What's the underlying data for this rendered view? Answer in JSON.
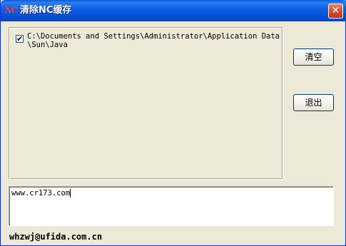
{
  "window": {
    "title": "清除NC缓存",
    "app_icon_text": "NC",
    "close_glyph": "✕"
  },
  "list": {
    "items": [
      {
        "checked": true,
        "path": "C:\\Documents and Settings\\Administrator\\Application Data\\Sun\\Java"
      }
    ],
    "check_glyph": "✔"
  },
  "buttons": {
    "clear_label": "清空",
    "exit_label": "退出"
  },
  "textbox": {
    "value": "www.cr173.com"
  },
  "footer": {
    "email": "whzwj@ufida.com.cn"
  }
}
